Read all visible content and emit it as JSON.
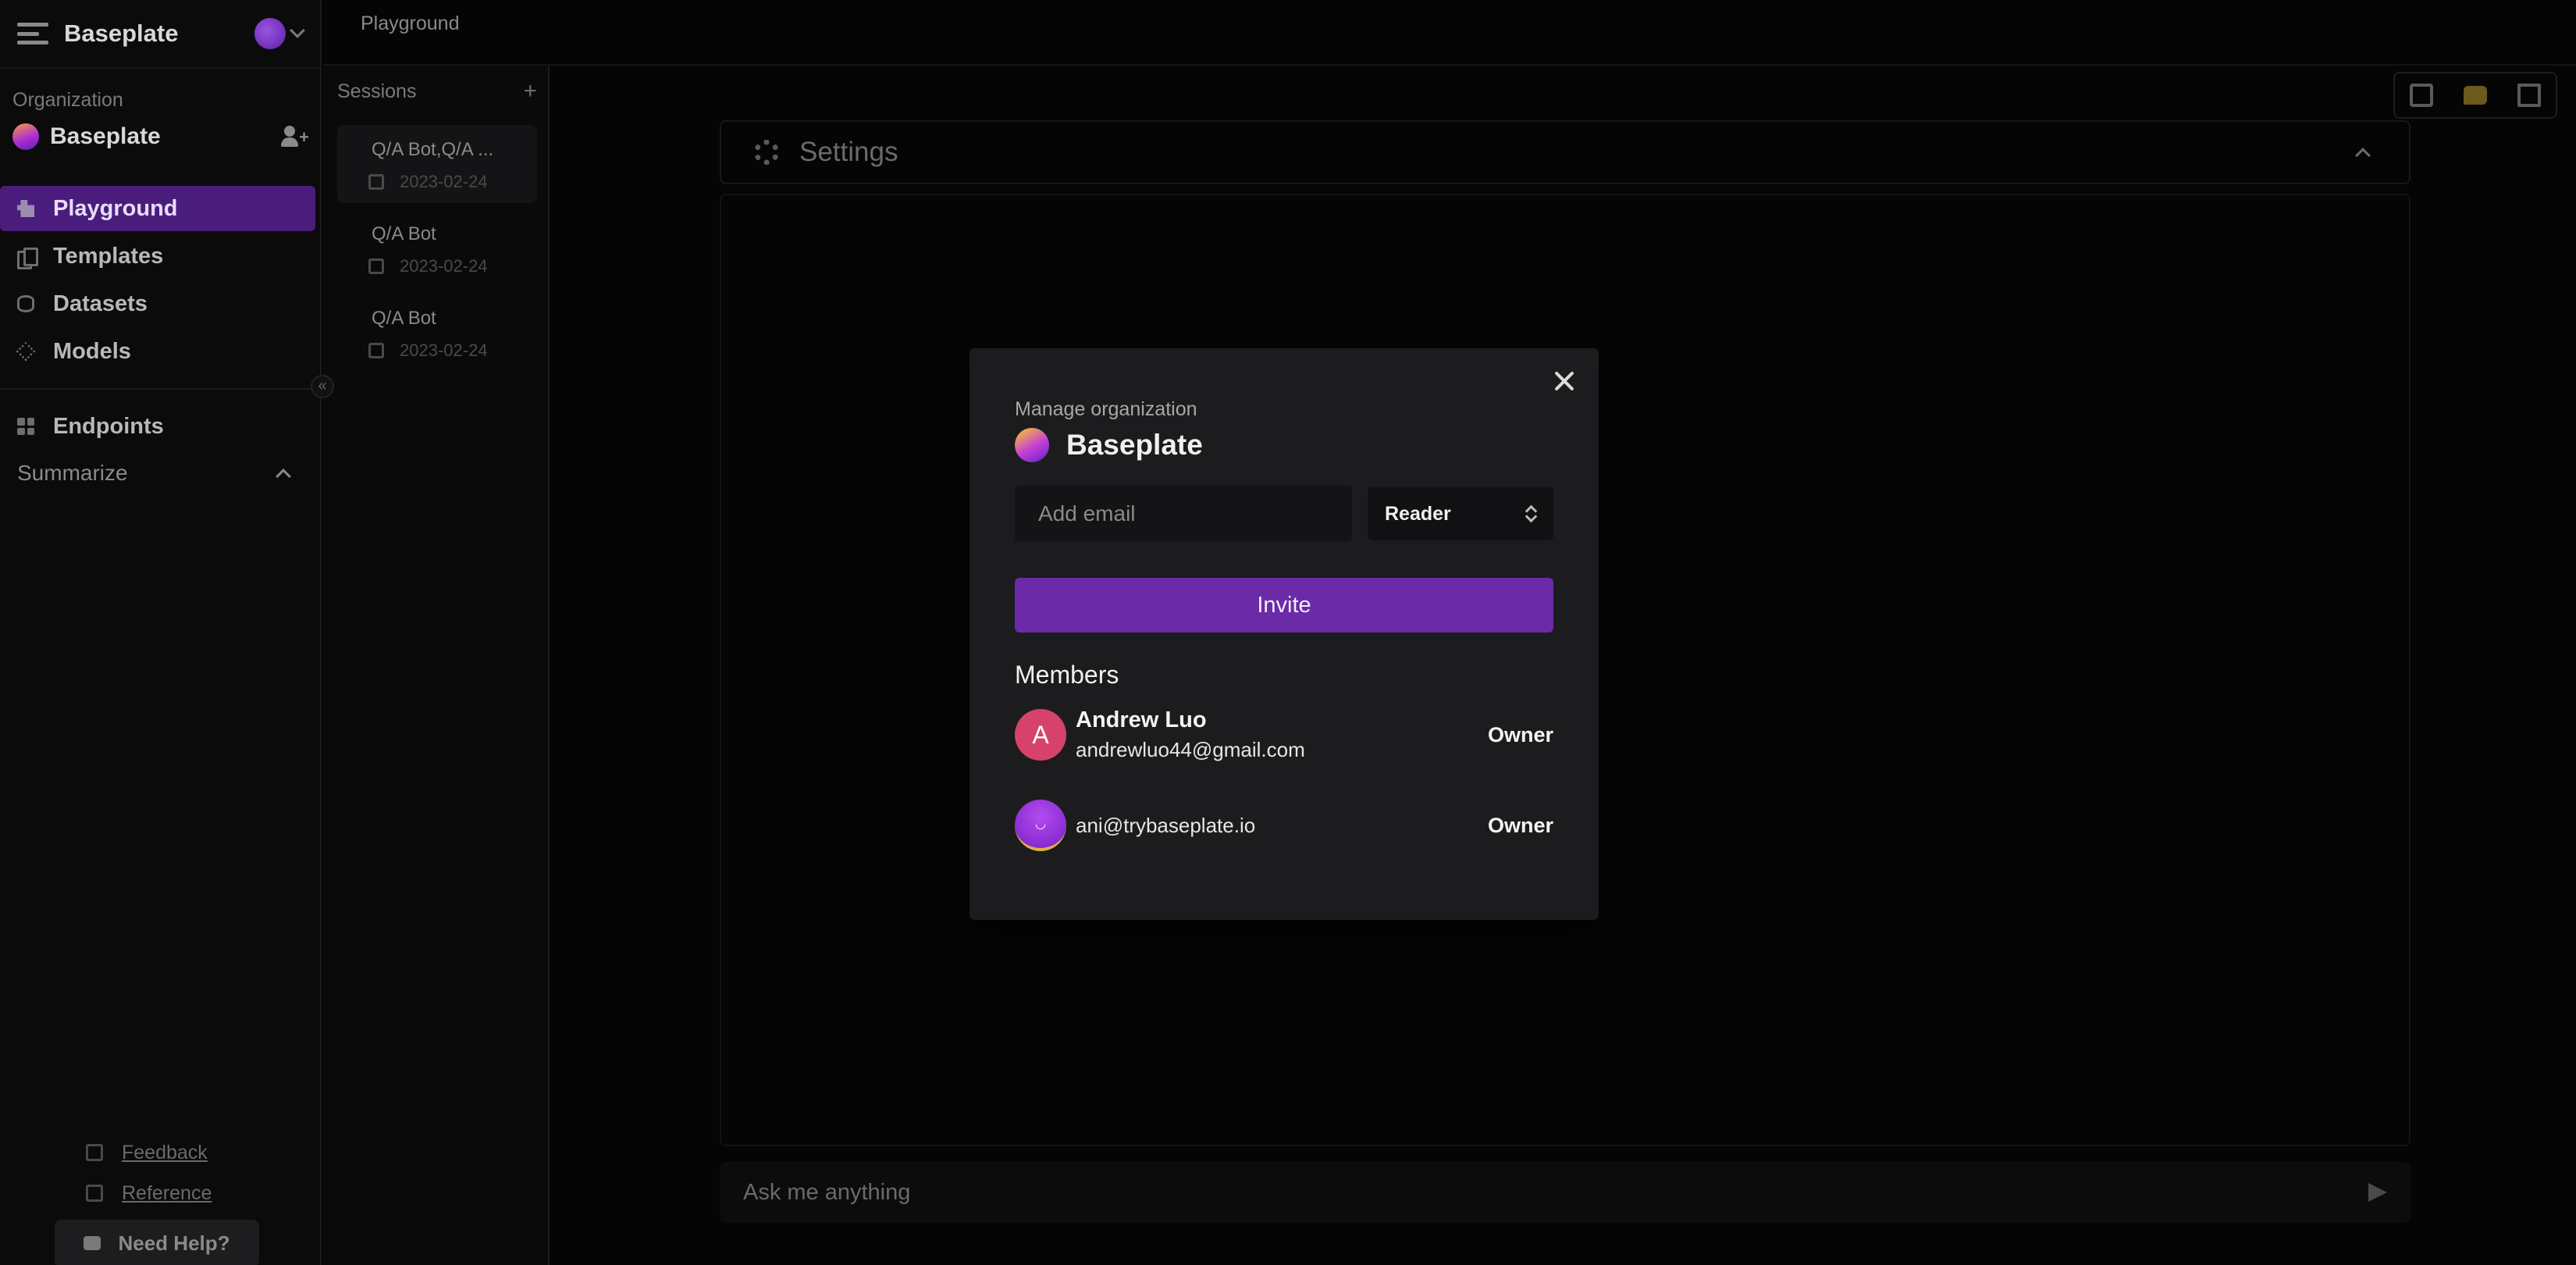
{
  "app": {
    "brand": "Baseplate",
    "breadcrumb": "Playground"
  },
  "sidebar": {
    "org_label": "Organization",
    "org_name": "Baseplate",
    "items": [
      {
        "label": "Playground",
        "icon": "puzzle-icon",
        "active": true
      },
      {
        "label": "Templates",
        "icon": "stack-icon",
        "active": false
      },
      {
        "label": "Datasets",
        "icon": "database-icon",
        "active": false
      },
      {
        "label": "Models",
        "icon": "cube-icon",
        "active": false
      }
    ],
    "endpoints_label": "Endpoints",
    "summarize_label": "Summarize",
    "feedback_label": "Feedback",
    "reference_label": "Reference",
    "help_label": "Need Help?"
  },
  "sessions": {
    "title": "Sessions",
    "items": [
      {
        "name": "Q/A Bot,Q/A ...",
        "date": "2023-02-24"
      },
      {
        "name": "Q/A Bot",
        "date": "2023-02-24"
      },
      {
        "name": "Q/A Bot",
        "date": "2023-02-24"
      }
    ]
  },
  "main": {
    "settings_label": "Settings",
    "ask_placeholder": "Ask me anything"
  },
  "modal": {
    "subtitle": "Manage organization",
    "title": "Baseplate",
    "email_placeholder": "Add email",
    "role_selected": "Reader",
    "invite_label": "Invite",
    "members_heading": "Members",
    "members": [
      {
        "initial": "A",
        "name": "Andrew Luo",
        "email": "andrewluo44@gmail.com",
        "role": "Owner"
      },
      {
        "initial": "",
        "name": "",
        "email": "ani@trybaseplate.io",
        "role": "Owner"
      }
    ]
  },
  "colors": {
    "accent": "#6b2aa7",
    "active_nav": "#4a1d7d",
    "avatar_red": "#d7426b"
  }
}
